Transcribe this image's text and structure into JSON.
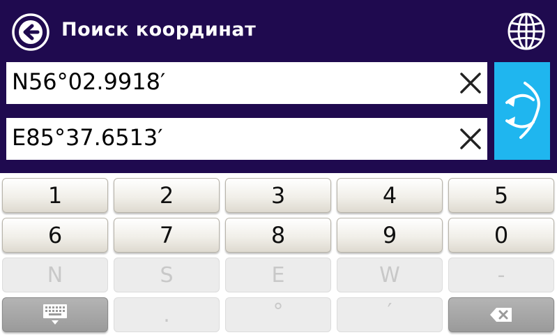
{
  "header": {
    "title": "Поиск координат",
    "back_icon": "arrow-left-circle-icon",
    "globe_icon": "globe-icon"
  },
  "fields": {
    "latitude": "N56°02.9918′",
    "longitude": "E85°37.6513′"
  },
  "colors": {
    "background": "#1f0a4f",
    "accent": "#1fb6ef"
  },
  "keyboard": {
    "row1": [
      "1",
      "2",
      "3",
      "4",
      "5"
    ],
    "row2": [
      "6",
      "7",
      "8",
      "9",
      "0"
    ],
    "row3": [
      "N",
      "S",
      "E",
      "W",
      "-"
    ],
    "row4": {
      "toggle_icon": "keyboard-icon",
      "dot": ".",
      "degree": "°",
      "minute": "′",
      "backspace_icon": "backspace-icon"
    }
  }
}
